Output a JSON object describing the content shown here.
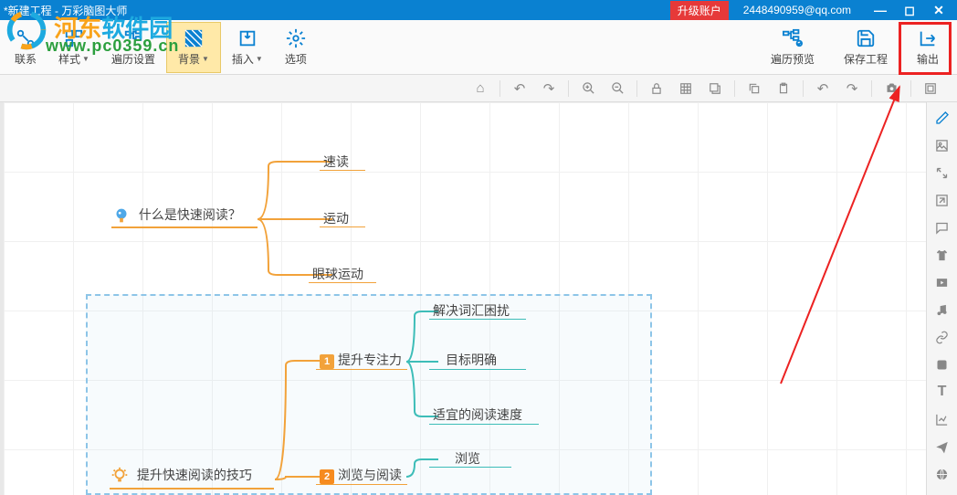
{
  "titlebar": {
    "title": "*新建工程 - 万彩脑图大师",
    "upgrade": "升级账户",
    "email": "2448490959@qq.com"
  },
  "toolbar": {
    "relation": "联系",
    "style": "样式",
    "traverse": "遍历设置",
    "background": "背景",
    "insert": "插入",
    "options": "选项",
    "preview": "遍历预览",
    "save": "保存工程",
    "export": "输出"
  },
  "mindmap": {
    "topic1": "什么是快速阅读？",
    "topic1_children": [
      "速读",
      "运动",
      "眼球运动"
    ],
    "topic2": "提升快速阅读的技巧",
    "topic2_sub1": "提升专注力",
    "topic2_sub1_children": [
      "解决词汇困扰",
      "目标明确",
      "适宜的阅读速度"
    ],
    "topic2_sub2": "浏览与阅读",
    "topic2_sub2_children": [
      "浏览"
    ]
  },
  "watermark": {
    "text1": "河东",
    "text2": "软件园",
    "url": "www.pc0359.cn"
  }
}
